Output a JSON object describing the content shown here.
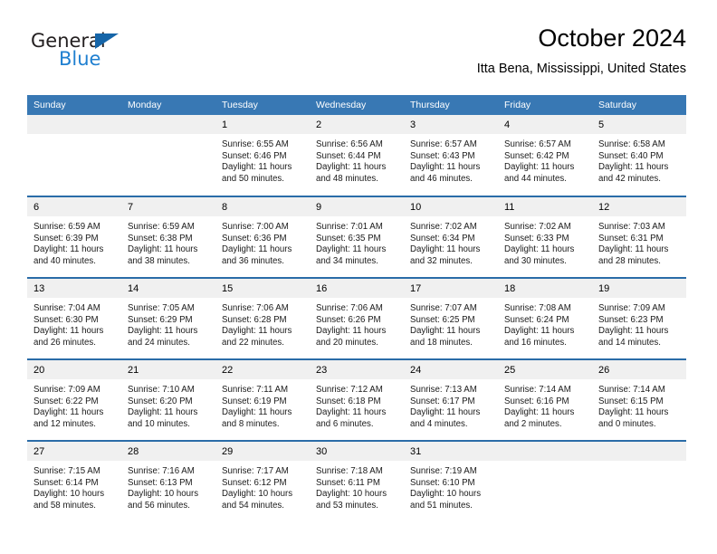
{
  "brand": {
    "name_top": "General",
    "name_bottom": "Blue",
    "triangle_icon": "triangle-logo-icon",
    "color_dark": "#231f20",
    "color_blue": "#1f7fd0"
  },
  "header": {
    "title": "October 2024",
    "subtitle": "Itta Bena, Mississippi, United States"
  },
  "theme": {
    "header_bg": "#3878b4",
    "row_divider": "#2a6ca8",
    "daynum_bg": "#f0f0f0"
  },
  "weekday_headers": [
    "Sunday",
    "Monday",
    "Tuesday",
    "Wednesday",
    "Thursday",
    "Friday",
    "Saturday"
  ],
  "weeks": [
    [
      {
        "day": "",
        "sunrise": "",
        "sunset": "",
        "daylight_1": "",
        "daylight_2": ""
      },
      {
        "day": "",
        "sunrise": "",
        "sunset": "",
        "daylight_1": "",
        "daylight_2": ""
      },
      {
        "day": "1",
        "sunrise": "Sunrise: 6:55 AM",
        "sunset": "Sunset: 6:46 PM",
        "daylight_1": "Daylight: 11 hours",
        "daylight_2": "and 50 minutes."
      },
      {
        "day": "2",
        "sunrise": "Sunrise: 6:56 AM",
        "sunset": "Sunset: 6:44 PM",
        "daylight_1": "Daylight: 11 hours",
        "daylight_2": "and 48 minutes."
      },
      {
        "day": "3",
        "sunrise": "Sunrise: 6:57 AM",
        "sunset": "Sunset: 6:43 PM",
        "daylight_1": "Daylight: 11 hours",
        "daylight_2": "and 46 minutes."
      },
      {
        "day": "4",
        "sunrise": "Sunrise: 6:57 AM",
        "sunset": "Sunset: 6:42 PM",
        "daylight_1": "Daylight: 11 hours",
        "daylight_2": "and 44 minutes."
      },
      {
        "day": "5",
        "sunrise": "Sunrise: 6:58 AM",
        "sunset": "Sunset: 6:40 PM",
        "daylight_1": "Daylight: 11 hours",
        "daylight_2": "and 42 minutes."
      }
    ],
    [
      {
        "day": "6",
        "sunrise": "Sunrise: 6:59 AM",
        "sunset": "Sunset: 6:39 PM",
        "daylight_1": "Daylight: 11 hours",
        "daylight_2": "and 40 minutes."
      },
      {
        "day": "7",
        "sunrise": "Sunrise: 6:59 AM",
        "sunset": "Sunset: 6:38 PM",
        "daylight_1": "Daylight: 11 hours",
        "daylight_2": "and 38 minutes."
      },
      {
        "day": "8",
        "sunrise": "Sunrise: 7:00 AM",
        "sunset": "Sunset: 6:36 PM",
        "daylight_1": "Daylight: 11 hours",
        "daylight_2": "and 36 minutes."
      },
      {
        "day": "9",
        "sunrise": "Sunrise: 7:01 AM",
        "sunset": "Sunset: 6:35 PM",
        "daylight_1": "Daylight: 11 hours",
        "daylight_2": "and 34 minutes."
      },
      {
        "day": "10",
        "sunrise": "Sunrise: 7:02 AM",
        "sunset": "Sunset: 6:34 PM",
        "daylight_1": "Daylight: 11 hours",
        "daylight_2": "and 32 minutes."
      },
      {
        "day": "11",
        "sunrise": "Sunrise: 7:02 AM",
        "sunset": "Sunset: 6:33 PM",
        "daylight_1": "Daylight: 11 hours",
        "daylight_2": "and 30 minutes."
      },
      {
        "day": "12",
        "sunrise": "Sunrise: 7:03 AM",
        "sunset": "Sunset: 6:31 PM",
        "daylight_1": "Daylight: 11 hours",
        "daylight_2": "and 28 minutes."
      }
    ],
    [
      {
        "day": "13",
        "sunrise": "Sunrise: 7:04 AM",
        "sunset": "Sunset: 6:30 PM",
        "daylight_1": "Daylight: 11 hours",
        "daylight_2": "and 26 minutes."
      },
      {
        "day": "14",
        "sunrise": "Sunrise: 7:05 AM",
        "sunset": "Sunset: 6:29 PM",
        "daylight_1": "Daylight: 11 hours",
        "daylight_2": "and 24 minutes."
      },
      {
        "day": "15",
        "sunrise": "Sunrise: 7:06 AM",
        "sunset": "Sunset: 6:28 PM",
        "daylight_1": "Daylight: 11 hours",
        "daylight_2": "and 22 minutes."
      },
      {
        "day": "16",
        "sunrise": "Sunrise: 7:06 AM",
        "sunset": "Sunset: 6:26 PM",
        "daylight_1": "Daylight: 11 hours",
        "daylight_2": "and 20 minutes."
      },
      {
        "day": "17",
        "sunrise": "Sunrise: 7:07 AM",
        "sunset": "Sunset: 6:25 PM",
        "daylight_1": "Daylight: 11 hours",
        "daylight_2": "and 18 minutes."
      },
      {
        "day": "18",
        "sunrise": "Sunrise: 7:08 AM",
        "sunset": "Sunset: 6:24 PM",
        "daylight_1": "Daylight: 11 hours",
        "daylight_2": "and 16 minutes."
      },
      {
        "day": "19",
        "sunrise": "Sunrise: 7:09 AM",
        "sunset": "Sunset: 6:23 PM",
        "daylight_1": "Daylight: 11 hours",
        "daylight_2": "and 14 minutes."
      }
    ],
    [
      {
        "day": "20",
        "sunrise": "Sunrise: 7:09 AM",
        "sunset": "Sunset: 6:22 PM",
        "daylight_1": "Daylight: 11 hours",
        "daylight_2": "and 12 minutes."
      },
      {
        "day": "21",
        "sunrise": "Sunrise: 7:10 AM",
        "sunset": "Sunset: 6:20 PM",
        "daylight_1": "Daylight: 11 hours",
        "daylight_2": "and 10 minutes."
      },
      {
        "day": "22",
        "sunrise": "Sunrise: 7:11 AM",
        "sunset": "Sunset: 6:19 PM",
        "daylight_1": "Daylight: 11 hours",
        "daylight_2": "and 8 minutes."
      },
      {
        "day": "23",
        "sunrise": "Sunrise: 7:12 AM",
        "sunset": "Sunset: 6:18 PM",
        "daylight_1": "Daylight: 11 hours",
        "daylight_2": "and 6 minutes."
      },
      {
        "day": "24",
        "sunrise": "Sunrise: 7:13 AM",
        "sunset": "Sunset: 6:17 PM",
        "daylight_1": "Daylight: 11 hours",
        "daylight_2": "and 4 minutes."
      },
      {
        "day": "25",
        "sunrise": "Sunrise: 7:14 AM",
        "sunset": "Sunset: 6:16 PM",
        "daylight_1": "Daylight: 11 hours",
        "daylight_2": "and 2 minutes."
      },
      {
        "day": "26",
        "sunrise": "Sunrise: 7:14 AM",
        "sunset": "Sunset: 6:15 PM",
        "daylight_1": "Daylight: 11 hours",
        "daylight_2": "and 0 minutes."
      }
    ],
    [
      {
        "day": "27",
        "sunrise": "Sunrise: 7:15 AM",
        "sunset": "Sunset: 6:14 PM",
        "daylight_1": "Daylight: 10 hours",
        "daylight_2": "and 58 minutes."
      },
      {
        "day": "28",
        "sunrise": "Sunrise: 7:16 AM",
        "sunset": "Sunset: 6:13 PM",
        "daylight_1": "Daylight: 10 hours",
        "daylight_2": "and 56 minutes."
      },
      {
        "day": "29",
        "sunrise": "Sunrise: 7:17 AM",
        "sunset": "Sunset: 6:12 PM",
        "daylight_1": "Daylight: 10 hours",
        "daylight_2": "and 54 minutes."
      },
      {
        "day": "30",
        "sunrise": "Sunrise: 7:18 AM",
        "sunset": "Sunset: 6:11 PM",
        "daylight_1": "Daylight: 10 hours",
        "daylight_2": "and 53 minutes."
      },
      {
        "day": "31",
        "sunrise": "Sunrise: 7:19 AM",
        "sunset": "Sunset: 6:10 PM",
        "daylight_1": "Daylight: 10 hours",
        "daylight_2": "and 51 minutes."
      },
      {
        "day": "",
        "sunrise": "",
        "sunset": "",
        "daylight_1": "",
        "daylight_2": ""
      },
      {
        "day": "",
        "sunrise": "",
        "sunset": "",
        "daylight_1": "",
        "daylight_2": ""
      }
    ]
  ]
}
